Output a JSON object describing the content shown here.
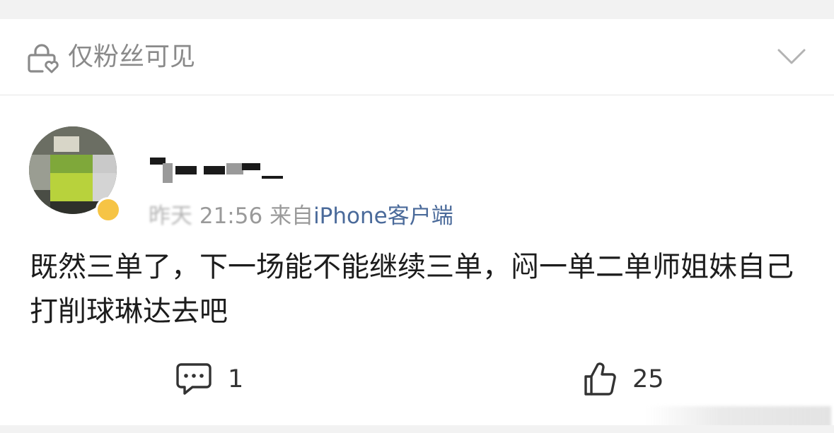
{
  "visibility": {
    "label": "仅粉丝可见",
    "icon": "lock-heart-icon",
    "expand_icon": "chevron-down-icon"
  },
  "post": {
    "author": {
      "avatar_icon": "avatar",
      "badge_color": "#f6c445"
    },
    "meta": {
      "day": "昨天",
      "time": "21:56",
      "from_prefix": "来自",
      "source": "iPhone客户端"
    },
    "text": "既然三单了，下一场能不能继续三单，闷一单二单师姐妹自己打削球琳达去吧"
  },
  "actions": {
    "comment": {
      "icon": "comment-icon",
      "count": "1"
    },
    "like": {
      "icon": "thumbs-up-icon",
      "count": "25"
    }
  },
  "colors": {
    "background": "#f2f2f2",
    "card": "#ffffff",
    "muted_text": "#8a8a8a",
    "link_text": "#4a6a9a"
  }
}
